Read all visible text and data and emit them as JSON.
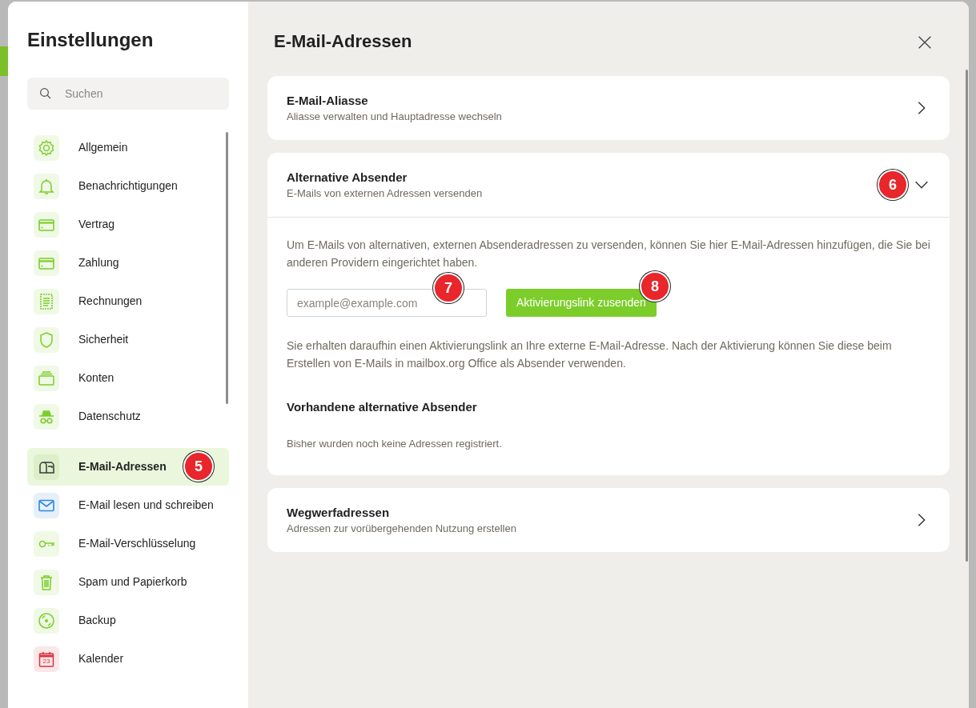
{
  "sidebar": {
    "title": "Einstellungen",
    "search": {
      "placeholder": "Suchen"
    },
    "groups": [
      [
        {
          "label": "Allgemein",
          "selected": false
        },
        {
          "label": "Benachrichtigungen",
          "selected": false
        },
        {
          "label": "Vertrag",
          "selected": false
        },
        {
          "label": "Zahlung",
          "selected": false
        },
        {
          "label": "Rechnungen",
          "selected": false
        },
        {
          "label": "Sicherheit",
          "selected": false
        },
        {
          "label": "Konten",
          "selected": false
        },
        {
          "label": "Datenschutz",
          "selected": false
        }
      ],
      [
        {
          "label": "E-Mail-Adressen",
          "selected": true,
          "marker": "5"
        },
        {
          "label": "E-Mail lesen und schreiben",
          "selected": false
        },
        {
          "label": "E-Mail-Verschlüsselung",
          "selected": false
        },
        {
          "label": "Spam und Papierkorb",
          "selected": false
        },
        {
          "label": "Backup",
          "selected": false
        },
        {
          "label": "Kalender",
          "selected": false,
          "icon_text": "23"
        }
      ]
    ]
  },
  "main": {
    "title": "E-Mail-Adressen",
    "sections": [
      {
        "title": "E-Mail-Aliasse",
        "subtitle": "Aliasse verwalten und Hauptadresse wechseln",
        "expanded": false
      },
      {
        "title": "Alternative Absender",
        "subtitle": "E-Mails von externen Adressen versenden",
        "expanded": true,
        "marker": "6",
        "body": {
          "intro": "Um E-Mails von alternativen, externen Absenderadressen zu versenden, können Sie hier E-Mail-Adressen hinzufügen, die Sie bei anderen Providern eingerichtet haben.",
          "input": {
            "placeholder": "example@example.com",
            "marker": "7"
          },
          "button": {
            "label": "Aktivierungslink zusenden",
            "marker": "8"
          },
          "note": "Sie erhalten daraufhin einen Aktivierungslink an Ihre externe E-Mail-Adresse. Nach der Aktivierung können Sie diese beim Erstellen von E-Mails in mailbox.org Office als Absender verwenden.",
          "subheading": "Vorhandene alternative Absender",
          "empty": "Bisher wurden noch keine Adressen registriert."
        }
      },
      {
        "title": "Wegwerfadressen",
        "subtitle": "Adressen zur vorübergehenden Nutzung erstellen",
        "expanded": false
      }
    ]
  }
}
